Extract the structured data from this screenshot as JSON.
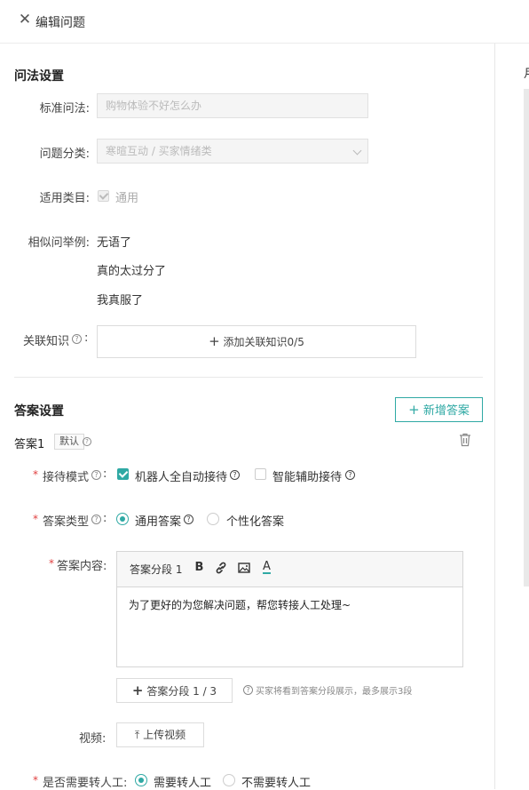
{
  "header": {
    "close_icon": "close-icon",
    "title": "编辑问题"
  },
  "right_panel": {
    "partial_label": "月"
  },
  "question_settings": {
    "section_title": "问法设置",
    "standard_question": {
      "label": "标准问法:",
      "value": "购物体验不好怎么办"
    },
    "category": {
      "label": "问题分类:",
      "value": "寒暄互动 / 买家情绪类"
    },
    "applicable": {
      "label": "适用类目:",
      "checkbox_label": "通用",
      "checked": true
    },
    "similar": {
      "label": "相似问举例:",
      "items": [
        "无语了",
        "真的太过分了",
        "我真服了"
      ]
    },
    "related": {
      "label": "关联知识",
      "colon": ":",
      "button_label": "添加关联知识0/5"
    }
  },
  "answer_settings": {
    "section_title": "答案设置",
    "add_answer_button": "新增答案",
    "answer_title": "答案1",
    "default_tag": "默认",
    "reception_mode": {
      "label": "接待模式",
      "options": [
        {
          "label": "机器人全自动接待",
          "checked": true
        },
        {
          "label": "智能辅助接待",
          "checked": false
        }
      ]
    },
    "answer_type": {
      "label": "答案类型",
      "options": [
        {
          "label": "通用答案",
          "selected": true
        },
        {
          "label": "个性化答案",
          "selected": false
        }
      ]
    },
    "answer_content": {
      "label": "答案内容:",
      "tab_label": "答案分段 1",
      "toolbar": {
        "bold": "B",
        "font_color": "A"
      },
      "text": "为了更好的为您解决问题，帮您转接人工处理~",
      "add_segment_button": "答案分段 1 / 3",
      "hint": "买家将看到答案分段展示，最多展示3段"
    },
    "video": {
      "label": "视频:",
      "upload_button": "上传视频"
    },
    "transfer": {
      "label": "是否需要转人工:",
      "options": [
        {
          "label": "需要转人工",
          "selected": true
        },
        {
          "label": "不需要转人工",
          "selected": false
        }
      ]
    }
  },
  "colors": {
    "accent": "#2fa9a4",
    "required": "#e04040"
  }
}
